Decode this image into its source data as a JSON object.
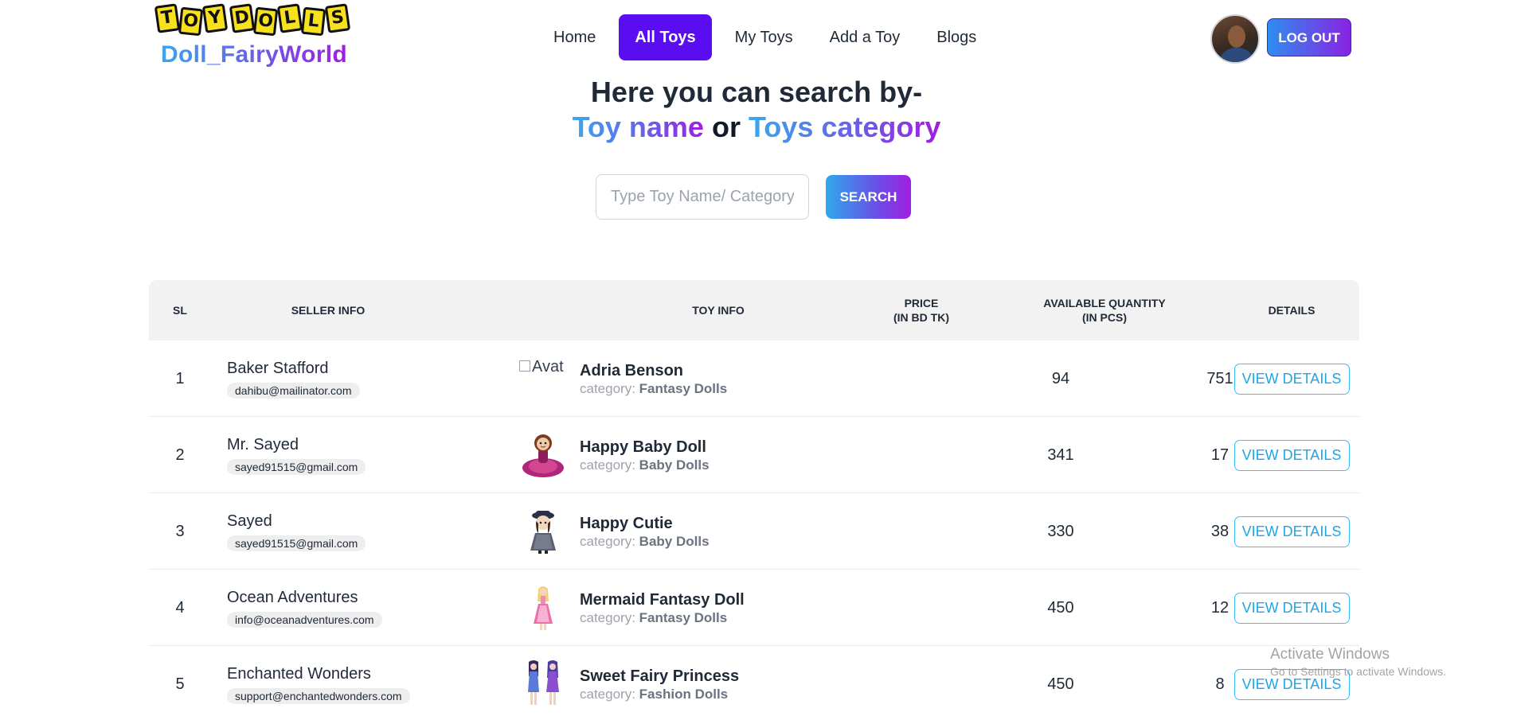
{
  "brand": {
    "badge_words": [
      "TOY",
      "DOLLS"
    ],
    "name": "Doll_FairyWorld"
  },
  "nav": {
    "items": [
      {
        "label": "Home",
        "active": false
      },
      {
        "label": "All Toys",
        "active": true
      },
      {
        "label": "My Toys",
        "active": false
      },
      {
        "label": "Add a Toy",
        "active": false
      },
      {
        "label": "Blogs",
        "active": false
      }
    ],
    "logout_label": "LOG OUT"
  },
  "hero": {
    "line1": "Here you can search by-",
    "term1": "Toy name",
    "or": "or",
    "term2": "Toys category"
  },
  "search": {
    "placeholder": "Type Toy Name/ Category",
    "value": "",
    "button_label": "SEARCH"
  },
  "table": {
    "headers": {
      "sl": "SL",
      "seller": "SELLER INFO",
      "toy": "TOY INFO",
      "price_line1": "PRICE",
      "price_line2": "(IN BD TK)",
      "qty_line1": "AVAILABLE QUANTITY",
      "qty_line2": "(IN PCS)",
      "details": "DETAILS"
    },
    "category_prefix": "category:",
    "details_label": "VIEW DETAILS",
    "rows": [
      {
        "sl": "1",
        "seller_name": "Baker Stafford",
        "seller_email": "dahibu@mailinator.com",
        "toy_name": "Adria Benson",
        "category": "Fantasy Dolls",
        "price": "94",
        "qty": "751",
        "image_alt": "Avat",
        "image": "broken"
      },
      {
        "sl": "2",
        "seller_name": "Mr. Sayed",
        "seller_email": "sayed91515@gmail.com",
        "toy_name": "Happy Baby Doll",
        "category": "Baby Dolls",
        "price": "341",
        "qty": "17",
        "image": "baby-doll-pink-dress"
      },
      {
        "sl": "3",
        "seller_name": "Sayed",
        "seller_email": "sayed91515@gmail.com",
        "toy_name": "Happy Cutie",
        "category": "Baby Dolls",
        "price": "330",
        "qty": "38",
        "image": "doll-navy-hat"
      },
      {
        "sl": "4",
        "seller_name": "Ocean Adventures",
        "seller_email": "info@oceanadventures.com",
        "toy_name": "Mermaid Fantasy Doll",
        "category": "Fantasy Dolls",
        "price": "450",
        "qty": "12",
        "image": "mermaid-doll-pink"
      },
      {
        "sl": "5",
        "seller_name": "Enchanted Wonders",
        "seller_email": "support@enchantedwonders.com",
        "toy_name": "Sweet Fairy Princess",
        "category": "Fashion Dolls",
        "price": "450",
        "qty": "8",
        "image": "two-fashion-dolls"
      }
    ]
  },
  "watermark": {
    "title": "Activate Windows",
    "subtitle": "Go to Settings to activate Windows."
  },
  "colors": {
    "nav_active": "#5b0df2",
    "accent_blue": "#38a9f0",
    "accent_purple": "#a21ce3",
    "details_border": "#38bdf8"
  }
}
